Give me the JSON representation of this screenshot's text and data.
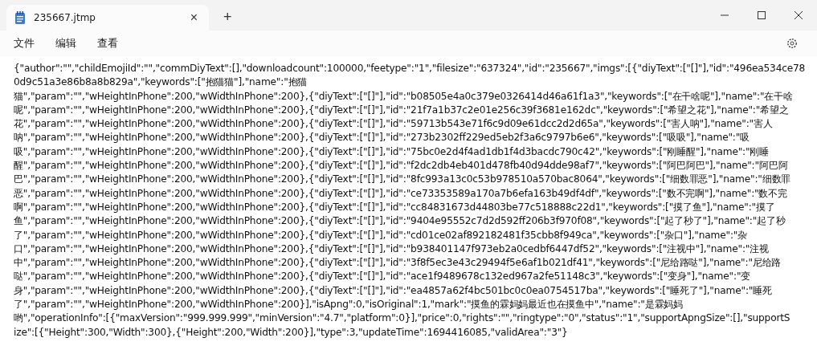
{
  "window": {
    "tab_title": "235667.jtmp",
    "tab_close": "×",
    "new_tab": "+",
    "controls": [
      {
        "kind": "minimize"
      },
      {
        "kind": "maximize"
      },
      {
        "kind": "close"
      }
    ]
  },
  "menu": [
    "文件",
    "编辑",
    "查看"
  ],
  "editor": {
    "lines": [
      "{\"author\":\"\",\"childEmojiId\":\"\",\"commDiyText\":[],\"downloadcount\":100000,\"feetype\":\"1\",\"filesize\":\"637324\",\"id\":\"235667\",\"imgs\":[{\"diyText\":[\"[]\"],\"id\":\"496ea534ce78",
      "0d9c51a3e86b8a8b829a\",\"keywords\":[\"抱猫猫\"],\"name\":\"抱猫",
      "猫\",\"param\":\"\",\"wHeightInPhone\":200,\"wWidthInPhone\":200},{\"diyText\":[\"[]\"],\"id\":\"b08505e4a0c379e0326414d46a61f1a3\",\"keywords\":[\"在干啥呢\"],\"name\":\"在干啥",
      "呢\",\"param\":\"\",\"wHeightInPhone\":200,\"wWidthInPhone\":200},{\"diyText\":[\"[]\"],\"id\":\"21f7a1b37c2e01e256c39f3681e162dc\",\"keywords\":[\"希望之花\"],\"name\":\"希望之",
      "花\",\"param\":\"\",\"wHeightInPhone\":200,\"wWidthInPhone\":200},{\"diyText\":[\"[]\"],\"id\":\"59713b543e71f6c9d09e61dcc2d2d65a\",\"keywords\":[\"害人呐\"],\"name\":\"害人",
      "呐\",\"param\":\"\",\"wHeightInPhone\":200,\"wWidthInPhone\":200},{\"diyText\":[\"[]\"],\"id\":\"273b2302ff229ed5eb2f3a6c9797b6e6\",\"keywords\":[\"吸吸\"],\"name\":\"吸",
      "吸\",\"param\":\"\",\"wHeightInPhone\":200,\"wWidthInPhone\":200},{\"diyText\":[\"[]\"],\"id\":\"75bc0e2d4f4ad1db1f4d3bacdc790c42\",\"keywords\":[\"刚睡醒\"],\"name\":\"刚睡",
      "醒\",\"param\":\"\",\"wHeightInPhone\":200,\"wWidthInPhone\":200},{\"diyText\":[\"[]\"],\"id\":\"f2dc2db4eb401d478fb40d94dde98af7\",\"keywords\":[\"阿巴阿巴\"],\"name\":\"阿巴阿",
      "巴\",\"param\":\"\",\"wHeightInPhone\":200,\"wWidthInPhone\":200},{\"diyText\":[\"[]\"],\"id\":\"8fc993a13c0c53b978510a570bac8064\",\"keywords\":[\"细数罪恶\"],\"name\":\"细数罪",
      "恶\",\"param\":\"\",\"wHeightInPhone\":200,\"wWidthInPhone\":200},{\"diyText\":[\"[]\"],\"id\":\"ce73353589a170a7b6efa163b49df4df\",\"keywords\":[\"数不完啊\"],\"name\":\"数不完",
      "啊\",\"param\":\"\",\"wHeightInPhone\":200,\"wWidthInPhone\":200},{\"diyText\":[\"[]\"],\"id\":\"cc84831673d44803be77c518888c22d1\",\"keywords\":[\"摸了鱼\"],\"name\":\"摸了",
      "鱼\",\"param\":\"\",\"wHeightInPhone\":200,\"wWidthInPhone\":200},{\"diyText\":[\"[]\"],\"id\":\"9404e95552c7d2d592ff206b3f970f08\",\"keywords\":[\"起了秒了\"],\"name\":\"起了秒",
      "了\",\"param\":\"\",\"wHeightInPhone\":200,\"wWidthInPhone\":200},{\"diyText\":[\"[]\"],\"id\":\"cd01ce02af892182481f35cbb8f949ca\",\"keywords\":[\"杂口\"],\"name\":\"杂",
      "口\",\"param\":\"\",\"wHeightInPhone\":200,\"wWidthInPhone\":200},{\"diyText\":[\"[]\"],\"id\":\"b938401147f973eb2a0cedbf6447df52\",\"keywords\":[\"注视中\"],\"name\":\"注视",
      "中\",\"param\":\"\",\"wHeightInPhone\":200,\"wWidthInPhone\":200},{\"diyText\":[\"[]\"],\"id\":\"3f8f5ec3e43c29494f5e6af1b021df41\",\"keywords\":[\"尼给路哒\"],\"name\":\"尼给路",
      "哒\",\"param\":\"\",\"wHeightInPhone\":200,\"wWidthInPhone\":200},{\"diyText\":[\"[]\"],\"id\":\"ace1f9489678c132ed967a2fe51148c3\",\"keywords\":[\"变身\"],\"name\":\"变",
      "身\",\"param\":\"\",\"wHeightInPhone\":200,\"wWidthInPhone\":200},{\"diyText\":[\"[]\"],\"id\":\"ea4857a62f4bc501bc0c0ea0754517ba\",\"keywords\":[\"睡死了\"],\"name\":\"睡死",
      "了\",\"param\":\"\",\"wHeightInPhone\":200,\"wWidthInPhone\":200}],\"isApng\":0,\"isOriginal\":1,\"mark\":\"摸鱼的霖妈妈最近也在摸鱼中\",\"name\":\"是霖妈妈",
      "哟\",\"operationInfo\":[{\"maxVersion\":\"999.999.999\",\"minVersion\":\"4.7\",\"platform\":0}],\"price\":0,\"rights\":\"\",\"ringtype\":\"0\",\"status\":\"1\",\"supportApngSize\":[],\"supportS",
      "ize\":[{\"Height\":300,\"Width\":300},{\"Height\":200,\"Width\":200}],\"type\":3,\"updateTime\":1694416085,\"validArea\":\"3\"}"
    ]
  }
}
